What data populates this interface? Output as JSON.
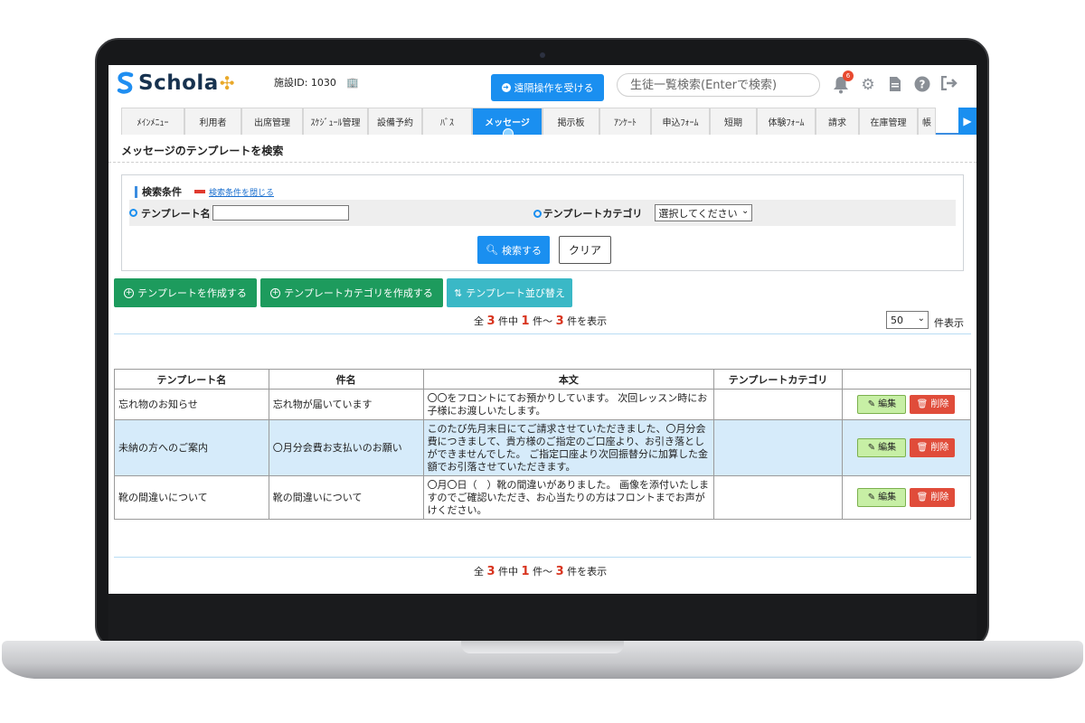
{
  "header": {
    "app_name": "Schola",
    "facility_id": "施設ID: 1030",
    "remote_button": "遠隔操作を受ける",
    "search_placeholder": "生徒一覧検索(Enterで検索)",
    "notification_count": "6"
  },
  "nav": {
    "tabs": [
      {
        "label": "ﾒｲﾝﾒﾆｭｰ",
        "active": false
      },
      {
        "label": "利用者",
        "active": false
      },
      {
        "label": "出席管理",
        "active": false
      },
      {
        "label": "ｽｹｼﾞｭｰﾙ管理",
        "active": false
      },
      {
        "label": "設備予約",
        "active": false
      },
      {
        "label": "ﾊﾞｽ",
        "active": false
      },
      {
        "label": "メッセージ",
        "active": true
      },
      {
        "label": "掲示板",
        "active": false
      },
      {
        "label": "ｱﾝｹｰﾄ",
        "active": false
      },
      {
        "label": "申込ﾌｫｰﾑ",
        "active": false
      },
      {
        "label": "短期",
        "active": false
      },
      {
        "label": "体験ﾌｫｰﾑ",
        "active": false
      },
      {
        "label": "請求",
        "active": false
      },
      {
        "label": "在庫管理",
        "active": false
      },
      {
        "label": "帳",
        "active": false
      }
    ],
    "next_arrow": "▶"
  },
  "page": {
    "title": "メッセージのテンプレートを検索"
  },
  "search": {
    "condition_label": "検索条件",
    "close_link": "検索条件を閉じる",
    "template_name_label": "テンプレート名",
    "template_name_value": "",
    "category_label": "テンプレートカテゴリ",
    "category_selected": "選択してください",
    "search_button": "検索する",
    "clear_button": "クリア"
  },
  "actions": {
    "create_template": "テンプレートを作成する",
    "create_category": "テンプレートカテゴリを作成する",
    "sort_templates": "テンプレート並び替え"
  },
  "pagination": {
    "prefix": "全",
    "total": "3",
    "mid1": "件中",
    "from": "1",
    "mid2": "件～",
    "to": "3",
    "suffix": "件を表示",
    "per_page": "50",
    "per_page_label": "件表示"
  },
  "table": {
    "headers": [
      "テンプレート名",
      "件名",
      "本文",
      "テンプレートカテゴリ",
      ""
    ],
    "edit_label": "編集",
    "delete_label": "削除",
    "rows": [
      {
        "name": "忘れ物のお知らせ",
        "subject": "忘れ物が届いています",
        "body": "〇〇をフロントにてお預かりしています。 次回レッスン時にお子様にお渡しいたします。",
        "category": "",
        "selected": false
      },
      {
        "name": "未納の方へのご案内",
        "subject": "〇月分会費お支払いのお願い",
        "body": "このたび先月末日にてご請求させていただきました、〇月分会費につきまして、貴方様のご指定のご口座より、お引き落としができませんでした。 ご指定口座より次回振替分に加算した金額でお引落させていただきます。",
        "category": "",
        "selected": true
      },
      {
        "name": "靴の間違いについて",
        "subject": "靴の間違いについて",
        "body": "〇月〇日（　）靴の間違いがありました。 画像を添付いたしますのでご確認いただき、お心当たりの方はフロントまでお声がけください。",
        "category": "",
        "selected": false
      }
    ]
  }
}
